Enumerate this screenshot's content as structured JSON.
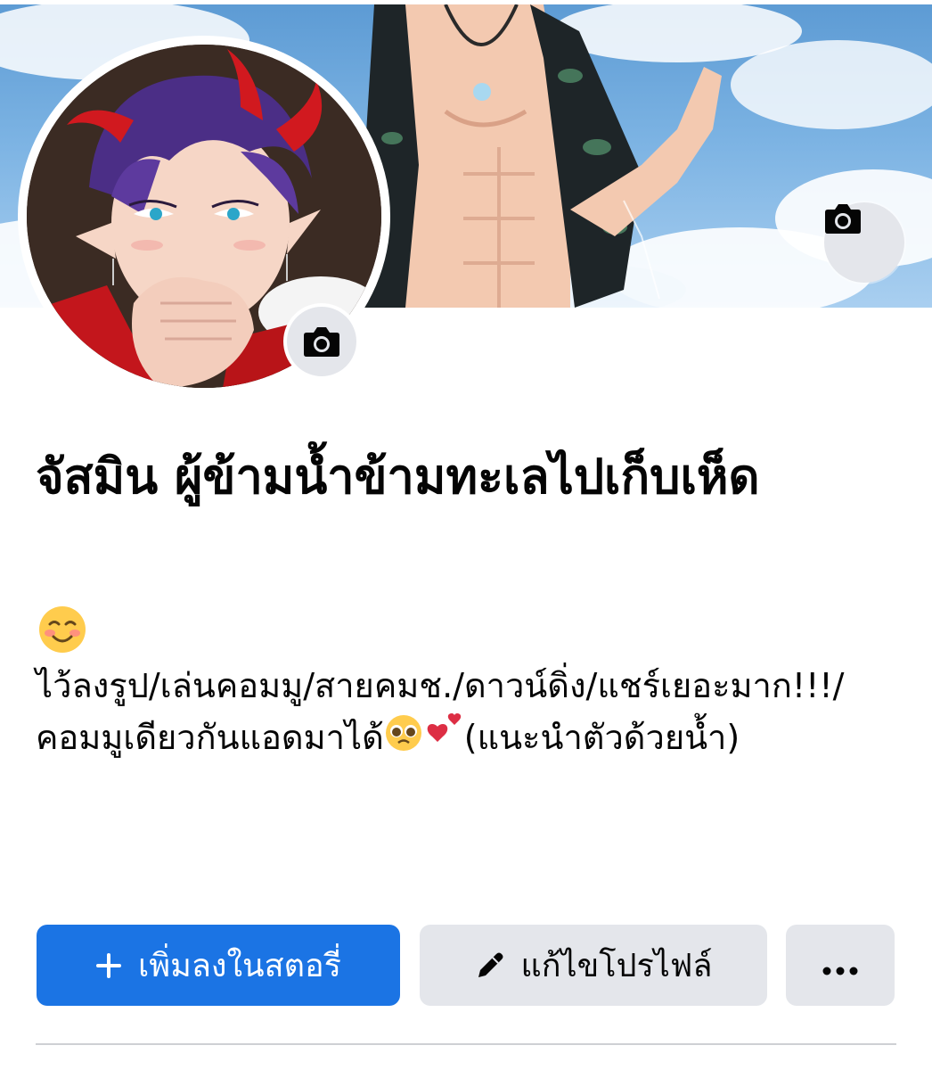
{
  "profile": {
    "name": "จัสมิน ผู้ข้ามน้ำข้ามทะเลไปเก็บเห็ด",
    "bio_emoji": "smiling-face-icon",
    "bio_text_1": "ไว้ลงรูป/เล่นคอมมู/สายคมช./ดาวน์ดิ่ง/แชร์เยอะมาก!!!/คอมมูเดียวกันแอดมาได้",
    "bio_text_2": "(แนะนำตัวด้วยน้ำ)"
  },
  "actions": {
    "add_story_label": "เพิ่มลงในสตอรี่",
    "edit_profile_label": "แก้ไขโปรไฟล์",
    "more_label": "···"
  },
  "icons": {
    "cover_camera": "camera-icon",
    "avatar_camera": "camera-icon",
    "add": "plus-icon",
    "edit": "pencil-icon",
    "more": "more-dots-icon"
  },
  "colors": {
    "primary": "#1b74e4",
    "secondary_button": "#e4e6eb",
    "text": "#050505",
    "divider": "#ced0d4"
  }
}
